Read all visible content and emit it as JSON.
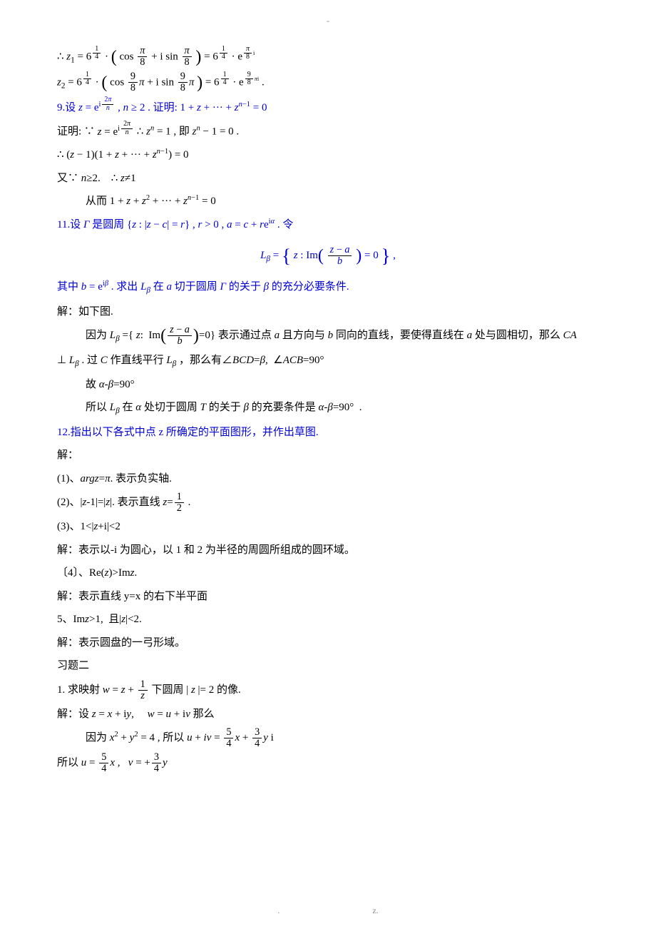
{
  "header_mark": "-",
  "eq_z1": "∴ z₁ = 6^{1/4} · ( cos (π/8) + i sin (π/8) ) = 6^{1/4} · e^{(π/8)i}",
  "eq_z2": "z₂ = 6^{1/4} · ( cos (9/8)π + i sin (9/8)π ) = 6^{1/4} · e^{(9/8)πi} .",
  "p9_stmt_a": "9.设 ",
  "p9_stmt_b": " , n ≥ 2 .  证明:  1 + z + ··· + zⁿ⁻¹ = 0",
  "p9_expr_z": "z = e^{i·2π/n}",
  "p9_proof_a": "证明:  ∵ ",
  "p9_proof_b": " ∴ zⁿ = 1 ,  即 zⁿ − 1 = 0 .",
  "p9_line2": "∴ (z − 1)(1 + z + ··· + zⁿ⁻¹) = 0",
  "p9_line3a": "又∵ n ≥ 2.    ∴ z ≠ 1",
  "p9_line3b": "从而 1 + z + z² + ··· + zⁿ⁻¹ = 0",
  "p11_stmt": "11.设 Γ 是圆周 { z : |z − c| = r } , r > 0 , a = c + r e^{iα} . 令",
  "p11_eq": "L_β = { z : Im( (z − a)/b ) = 0 } ,",
  "p11_cond": "其中 b = e^{iβ} . 求出 L_β 在 a 切于圆周 Γ 的关于 β 的充分必要条件.",
  "p11_sol_head": "解：如下图.",
  "p11_sol_a": "因为 L_β = { z:  Im( (z − a)/b ) = 0 } 表示通过点 a 且方向与 b 同向的直线，要使得直线在 a 处与圆相切，那么 CA",
  "p11_sol_b": "⊥ L_β .  过 C 作直线平行 L_β ，那么有 ∠BCD = β,  ∠ACB = 90°",
  "p11_sol_c": "故 α - β = 90°",
  "p11_sol_d": "所以 L_β 在 α 处切于圆周 T 的关于 β 的充要条件是 α - β = 90°  .",
  "p12_stmt": "12.指出以下各式中点 z 所确定的平面图形，并作出草图.",
  "p12_head": "解：",
  "p12_1": "(1)、argz=π. 表示负实轴.",
  "p12_2a": "(2)、|z-1|=|z|. 表示直线 z = ",
  "p12_2b": " .",
  "p12_3a": "(3)、1<|z+i|<2",
  "p12_3b": "解：表示以-i 为圆心，以 1 和 2 为半径的周圆所组成的圆环域。",
  "p12_4a": "〔4〕、Re(z)>Imz.",
  "p12_4b": "解：表示直线 y=x 的右下半平面",
  "p12_5a": "5、Imz>1,  且|z|<2.",
  "p12_5b": "解：表示圆盘的一弓形域。",
  "sec2": "习题二",
  "q1_a": "1.  求映射 ",
  "q1_b": " 下圆周 | z | = 2 的像.",
  "q1_expr": "w = z + 1/z",
  "q1_sol_a": "解：设 ",
  "q1_sol_expr1": "z = x + iy,     w = u + iv",
  "q1_sol_b": " 那么",
  "q1_line2a": "因为 ",
  "q1_line2_expr1": "x² + y² = 4",
  "q1_line2b": " , 所以 ",
  "q1_line2_expr2": "u + iv = (5/4)x + (3/4)y i",
  "q1_line3a": "所以 ",
  "q1_line3_expr": "u = (5/4)x ,  v = +(3/4)y",
  "footer_left": ".",
  "footer_right": "z."
}
